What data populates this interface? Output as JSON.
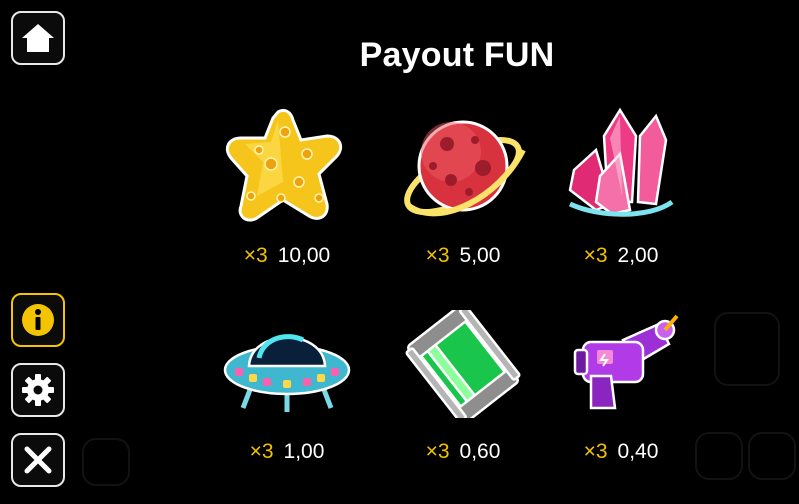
{
  "title": "Payout FUN",
  "sidebar": {
    "home": "home-icon",
    "info": "info-icon",
    "settings": "gear-icon",
    "close": "close-icon"
  },
  "colors": {
    "multiplier": "#f2c200",
    "info_border": "#f5c400",
    "button_border": "#e8e8e8"
  },
  "symbols": [
    {
      "icon": "star-icon",
      "multiplier": "×3",
      "value": "10,00"
    },
    {
      "icon": "planet-icon",
      "multiplier": "×3",
      "value": "5,00"
    },
    {
      "icon": "crystal-icon",
      "multiplier": "×3",
      "value": "2,00"
    },
    {
      "icon": "ufo-icon",
      "multiplier": "×3",
      "value": "1,00"
    },
    {
      "icon": "battery-icon",
      "multiplier": "×3",
      "value": "0,60"
    },
    {
      "icon": "ray-gun-icon",
      "multiplier": "×3",
      "value": "0,40"
    }
  ]
}
